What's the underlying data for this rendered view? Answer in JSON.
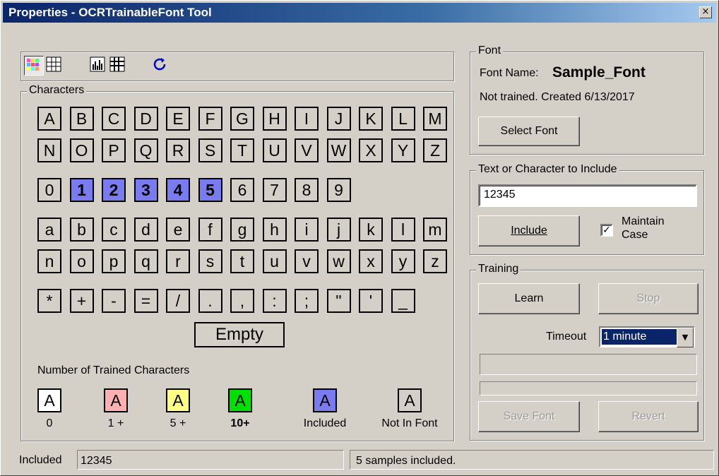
{
  "window": {
    "title": "Properties - OCRTrainableFont Tool",
    "close_glyph": "×"
  },
  "characters": {
    "legend": "Characters",
    "uppercase_row1": [
      "A",
      "B",
      "C",
      "D",
      "E",
      "F",
      "G",
      "H",
      "I",
      "J",
      "K",
      "L",
      "M"
    ],
    "uppercase_row2": [
      "N",
      "O",
      "P",
      "Q",
      "R",
      "S",
      "T",
      "U",
      "V",
      "W",
      "X",
      "Y",
      "Z"
    ],
    "digits": [
      "0",
      "1",
      "2",
      "3",
      "4",
      "5",
      "6",
      "7",
      "8",
      "9"
    ],
    "lowercase_row1": [
      "a",
      "b",
      "c",
      "d",
      "e",
      "f",
      "g",
      "h",
      "i",
      "j",
      "k",
      "l",
      "m"
    ],
    "lowercase_row2": [
      "n",
      "o",
      "p",
      "q",
      "r",
      "s",
      "t",
      "u",
      "v",
      "w",
      "x",
      "y",
      "z"
    ],
    "symbols": [
      "*",
      "+",
      "-",
      "=",
      "/",
      ".",
      ",",
      ":",
      ";",
      "\"",
      "'",
      "_"
    ],
    "included_characters": [
      "1",
      "2",
      "3",
      "4",
      "5"
    ],
    "empty_label": "Empty"
  },
  "legend_block": {
    "title": "Number of Trained Characters",
    "swatches": [
      {
        "letter": "A",
        "label": "0",
        "color": "#ffffff"
      },
      {
        "letter": "A",
        "label": "1 +",
        "color": "#ffb0b0"
      },
      {
        "letter": "A",
        "label": "5 +",
        "color": "#ffff88"
      },
      {
        "letter": "A",
        "label": "10+",
        "color": "#00e000"
      },
      {
        "letter": "A",
        "label": "Included",
        "color": "#7b7bf0"
      },
      {
        "letter": "A",
        "label": "Not In Font",
        "color": "#d4d0c8"
      }
    ]
  },
  "font": {
    "legend": "Font",
    "name_label": "Font Name:",
    "name_value": "Sample_Font",
    "status": "Not trained. Created 6/13/2017",
    "select_button": "Select Font"
  },
  "include": {
    "legend": "Text or Character to Include",
    "input_value": "12345",
    "include_button": "Include",
    "maintain_case_line1": "Maintain",
    "maintain_case_line2": "Case",
    "maintain_case_checked": true
  },
  "training": {
    "legend": "Training",
    "learn_button": "Learn",
    "stop_button": "Stop",
    "timeout_label": "Timeout",
    "timeout_value": "1 minute",
    "save_button": "Save Font",
    "revert_button": "Revert"
  },
  "status_bar": {
    "included_label": "Included",
    "included_value": "12345",
    "message": "5 samples included."
  },
  "colors": {
    "included": "#7b7bf0",
    "titlebar": "#0a246a",
    "face": "#d4d0c8"
  }
}
